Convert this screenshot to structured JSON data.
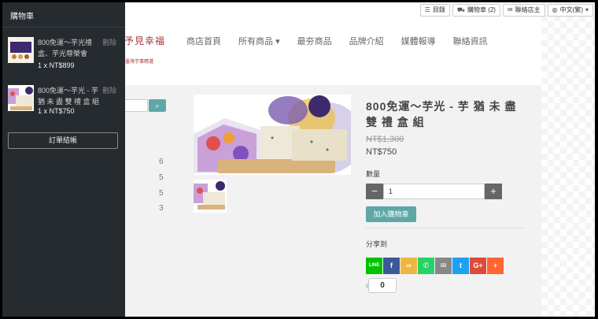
{
  "topbar": {
    "menu": "目錄",
    "cart": "購物車 (2)",
    "contact": "聯絡店主",
    "lang": "中文(繁)"
  },
  "logo": {
    "text": "予見幸福",
    "sub": "臺灣芋事精選"
  },
  "nav": {
    "items": [
      "商店首頁",
      "所有商品",
      "最夯商品",
      "品牌介紹",
      "媒體報導",
      "聯絡資訊"
    ],
    "dropdown_index": 1
  },
  "sidebar": {
    "counts": [
      "6",
      "5",
      "5",
      "3"
    ]
  },
  "product": {
    "title": "800免運～芋光 - 芋 猶 未 盡 雙 禮 盒 組",
    "old_price": "NT$1,300",
    "price": "NT$750",
    "qty_label": "數量",
    "qty_minus": "−",
    "qty_value": "1",
    "qty_plus": "+",
    "add_to_cart": "加入購物車",
    "share_label": "分享到",
    "share_count": "0",
    "share_colors": [
      "#00c300",
      "#3b5998",
      "#f0b640",
      "#25d366",
      "#888888",
      "#1da1f2",
      "#dd4b39",
      "#ff6633"
    ],
    "share_icons": [
      "line-icon",
      "facebook-icon",
      "weibo-icon",
      "whatsapp-icon",
      "email-icon",
      "twitter-icon",
      "google-plus-icon",
      "more-share-icon"
    ],
    "share_glyphs": [
      "LINE",
      "f",
      "∞",
      "✆",
      "✉",
      "t",
      "G+",
      "+"
    ]
  },
  "cart": {
    "title": "購物車",
    "items": [
      {
        "name": "800免運～芋光禮盒、芋光尊榮會",
        "remove": "刪除",
        "qty_price": "1 x  NT$899"
      },
      {
        "name": "800免運～芋光 - 芋 猶 未 盡 雙 禮 盒 組",
        "remove": "刪除",
        "qty_price": "1 x  NT$750"
      }
    ],
    "checkout": "訂單結帳"
  },
  "colors": {
    "accent": "#5fa7a7",
    "panel": "#262b30"
  }
}
